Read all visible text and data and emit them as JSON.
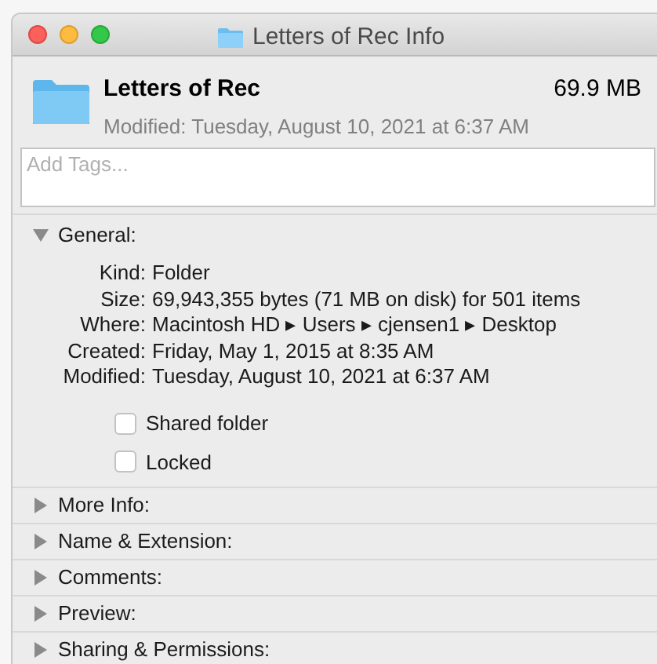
{
  "window": {
    "title": "Letters of Rec Info"
  },
  "header": {
    "name": "Letters of Rec",
    "size": "69.9 MB",
    "modified": "Modified: Tuesday, August 10, 2021 at 6:37 AM"
  },
  "tags": {
    "placeholder": "Add Tags..."
  },
  "general": {
    "label": "General:",
    "expanded": true,
    "rows": [
      {
        "label": "Kind:",
        "value": "Folder"
      },
      {
        "label": "Size:",
        "value": "69,943,355 bytes (71 MB on disk) for 501 items"
      },
      {
        "label": "Where:",
        "value": "Macintosh HD ▸ Users ▸ cjensen1 ▸ Desktop"
      },
      {
        "label": "Created:",
        "value": "Friday, May 1, 2015 at 8:35 AM"
      },
      {
        "label": "Modified:",
        "value": "Tuesday, August 10, 2021 at 6:37 AM"
      }
    ],
    "options": [
      {
        "label": "Shared folder",
        "checked": false
      },
      {
        "label": "Locked",
        "checked": false
      }
    ]
  },
  "sections": [
    {
      "label": "More Info:",
      "expanded": false
    },
    {
      "label": "Name & Extension:",
      "expanded": false
    },
    {
      "label": "Comments:",
      "expanded": false
    },
    {
      "label": "Preview:",
      "expanded": false
    },
    {
      "label": "Sharing & Permissions:",
      "expanded": false
    }
  ]
}
